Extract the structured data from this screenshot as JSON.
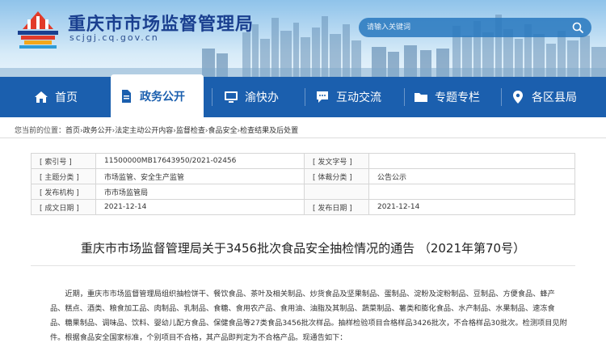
{
  "header": {
    "site_title": "重庆市市场监督管理局",
    "site_domain": "scjgj.cq.gov.cn",
    "search": {
      "placeholder": "请输入关键词"
    }
  },
  "nav": {
    "items": [
      {
        "label": "首页",
        "icon": "home-icon"
      },
      {
        "label": "政务公开",
        "icon": "document-icon",
        "active": true
      },
      {
        "label": "渝快办",
        "icon": "monitor-icon"
      },
      {
        "label": "互动交流",
        "icon": "chat-icon"
      },
      {
        "label": "专题专栏",
        "icon": "folder-icon"
      },
      {
        "label": "各区县局",
        "icon": "location-pin-icon"
      }
    ]
  },
  "breadcrumb": {
    "prefix": "您当前的位置：",
    "items": [
      "首页",
      "政务公开",
      "法定主动公开内容",
      "监督检查",
      "食品安全",
      "检查结果及后处置"
    ],
    "separator": "›"
  },
  "info": {
    "rows": [
      {
        "l1": "[ 索引号 ]",
        "v1": "11500000MB17643950/2021-02456",
        "l2": "[ 发文字号 ]",
        "v2": ""
      },
      {
        "l1": "[ 主题分类 ]",
        "v1": "市场监管、安全生产监管",
        "l2": "[ 体裁分类 ]",
        "v2": "公告公示"
      },
      {
        "l1": "[ 发布机构 ]",
        "v1": "市市场监管局",
        "l2": "",
        "v2": ""
      },
      {
        "l1": "[ 成文日期 ]",
        "v1": "2021-12-14",
        "l2": "[ 发布日期 ]",
        "v2": "2021-12-14"
      }
    ]
  },
  "article": {
    "title": "重庆市市场监督管理局关于3456批次食品安全抽检情况的通告 （2021年第70号）",
    "body": "近期，重庆市市场监督管理局组织抽检饼干、餐饮食品、茶叶及相关制品、炒货食品及坚果制品、蛋制品、淀粉及淀粉制品、豆制品、方便食品、蜂产品、糕点、酒类、粮食加工品、肉制品、乳制品、食糖、食用农产品、食用油、油脂及其制品、蔬菜制品、薯类和膨化食品、水产制品、水果制品、速冻食品、糖果制品、调味品、饮料、婴幼儿配方食品、保健食品等27类食品3456批次样品。抽样检验项目合格样品3426批次，不合格样品30批次。检测项目见附件。根据食品安全国家标准，个别项目不合格，其产品即判定为不合格产品。现通告如下："
  },
  "colors": {
    "nav_bg": "#1b5fae",
    "title_blue": "#1a3f8f"
  }
}
